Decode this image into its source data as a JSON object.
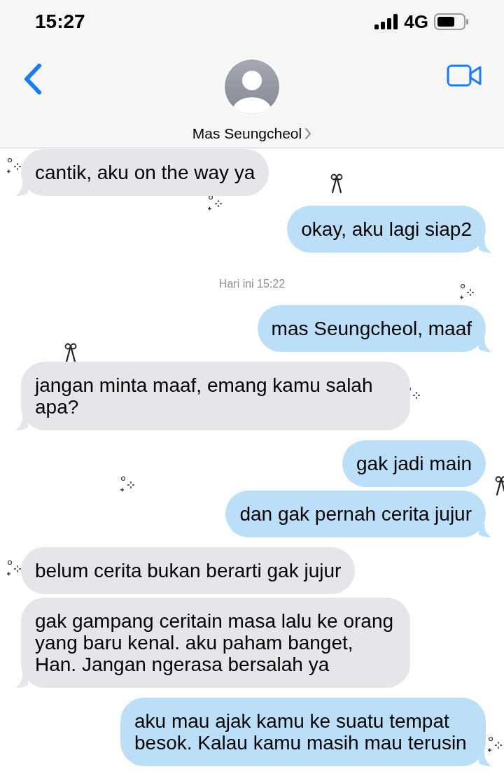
{
  "status_bar": {
    "time": "15:27",
    "network": "4G"
  },
  "header": {
    "contact_name": "Mas Seungcheol"
  },
  "messages": [
    {
      "kind": "received",
      "text": "cantik, aku on the way ya"
    },
    {
      "kind": "sent",
      "text": "okay, aku lagi siap2"
    },
    {
      "kind": "timestamp",
      "text": "Hari ini 15:22"
    },
    {
      "kind": "sent",
      "text": "mas Seungcheol, maaf"
    },
    {
      "kind": "received",
      "text": "jangan minta maaf, emang kamu salah apa?"
    },
    {
      "kind": "sent",
      "text": "gak jadi main"
    },
    {
      "kind": "sent",
      "text": "dan gak pernah cerita jujur"
    },
    {
      "kind": "received",
      "text": "belum cerita bukan berarti gak jujur"
    },
    {
      "kind": "received",
      "text": "gak gampang ceritain masa lalu ke orang yang baru kenal. aku paham banget, Han. Jangan ngerasa bersalah ya"
    },
    {
      "kind": "sent",
      "text": "aku mau ajak kamu ke suatu tempat besok. Kalau kamu masih mau terusin"
    }
  ]
}
